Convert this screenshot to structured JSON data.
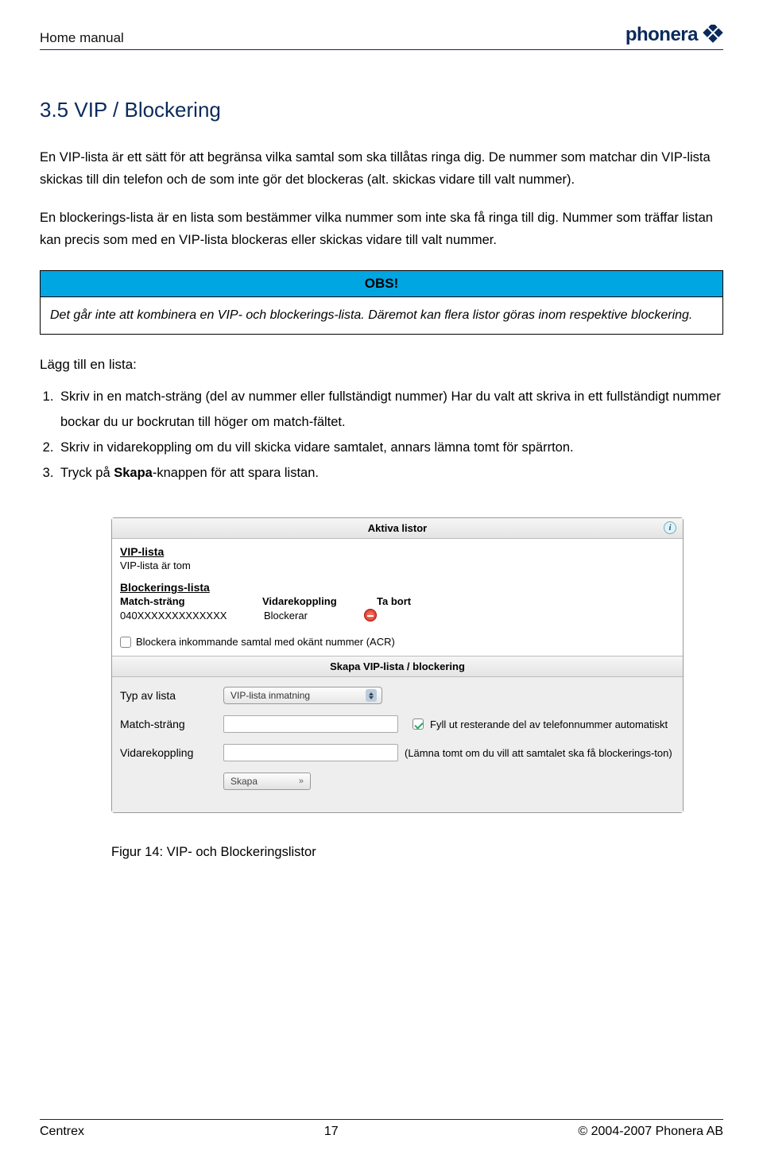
{
  "header": {
    "title": "Home manual",
    "brand": "phonera"
  },
  "section": {
    "heading": "3.5 VIP / Blockering",
    "para1": "En VIP-lista är ett sätt för att begränsa vilka samtal som ska tillåtas ringa dig. De nummer som matchar din VIP-lista skickas till din telefon och de som inte gör det blockeras (alt. skickas vidare till valt nummer).",
    "para2": "En blockerings-lista är en lista som bestämmer vilka nummer som inte ska få ringa till dig. Nummer som träffar listan kan precis som med en VIP-lista blockeras eller skickas vidare till valt nummer."
  },
  "obs": {
    "title": "OBS!",
    "body": "Det går inte att kombinera en VIP- och blockerings-lista. Däremot kan flera listor göras inom respektive blockering."
  },
  "addlist": {
    "title": "Lägg till en lista:",
    "step1": "Skriv in en match-sträng (del av nummer eller fullständigt nummer) Har du valt att skriva in ett fullständigt nummer bockar du ur bockrutan till höger om match-fältet.",
    "step2": "Skriv in vidarekoppling om du vill skicka vidare samtalet, annars lämna tomt för spärrton.",
    "step3a": "Tryck på ",
    "step3b": "Skapa",
    "step3c": "-knappen för att spara listan."
  },
  "panel": {
    "title1": "Aktiva listor",
    "vip_h": "VIP-lista",
    "vip_empty": "VIP-lista är tom",
    "block_h": "Blockerings-lista",
    "col_match": "Match-sträng",
    "col_forward": "Vidarekoppling",
    "col_remove": "Ta bort",
    "row_match": "040XXXXXXXXXXXXX",
    "row_forward": "Blockerar",
    "acr": "Blockera inkommande samtal med okänt nummer (ACR)",
    "title2": "Skapa VIP-lista / blockering",
    "label_type": "Typ av lista",
    "select_value": "VIP-lista inmatning",
    "label_match": "Match-sträng",
    "hint_fill": "Fyll ut resterande del av telefonnummer automatiskt",
    "label_forward": "Vidarekoppling",
    "hint_forward": "(Lämna tomt om du vill att samtalet ska få blockerings-ton)",
    "create": "Skapa"
  },
  "caption": "Figur 14: VIP- och Blockeringslistor",
  "footer": {
    "left": "Centrex",
    "center": "17",
    "right": "© 2004-2007 Phonera AB"
  }
}
